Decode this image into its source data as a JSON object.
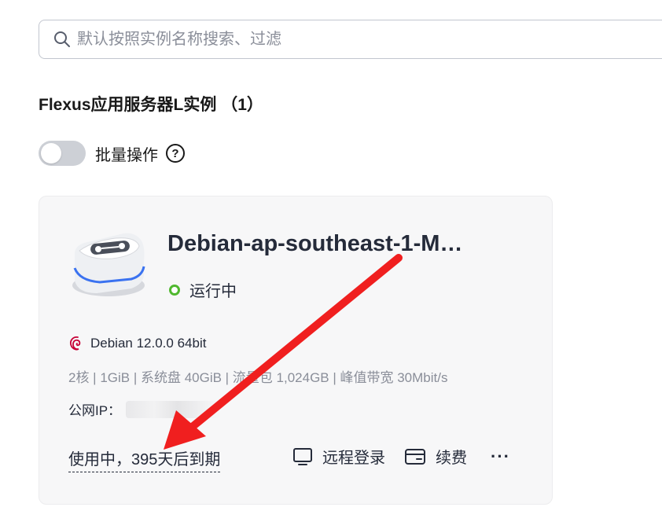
{
  "search": {
    "placeholder": "默认按照实例名称搜索、过滤"
  },
  "section": {
    "title": "Flexus应用服务器L实例 （1）"
  },
  "batch": {
    "label": "批量操作",
    "help_glyph": "?",
    "enabled": false
  },
  "instance": {
    "name": "Debian-ap-southeast-1-M…",
    "status": "运行中",
    "os": "Debian 12.0.0 64bit",
    "specs": "2核 | 1GiB | 系统盘 40GiB | 流量包 1,024GB | 峰值带宽 30Mbit/s",
    "ip_label": "公网IP：",
    "expiry": "使用中，395天后到期",
    "actions": [
      {
        "label": "远程登录",
        "icon": "monitor-icon"
      },
      {
        "label": "续费",
        "icon": "wallet-icon"
      }
    ],
    "more": "···"
  },
  "colors": {
    "status_green": "#50b82f",
    "annotation_red": "#f01f1f",
    "server_accent": "#3a72f0"
  }
}
